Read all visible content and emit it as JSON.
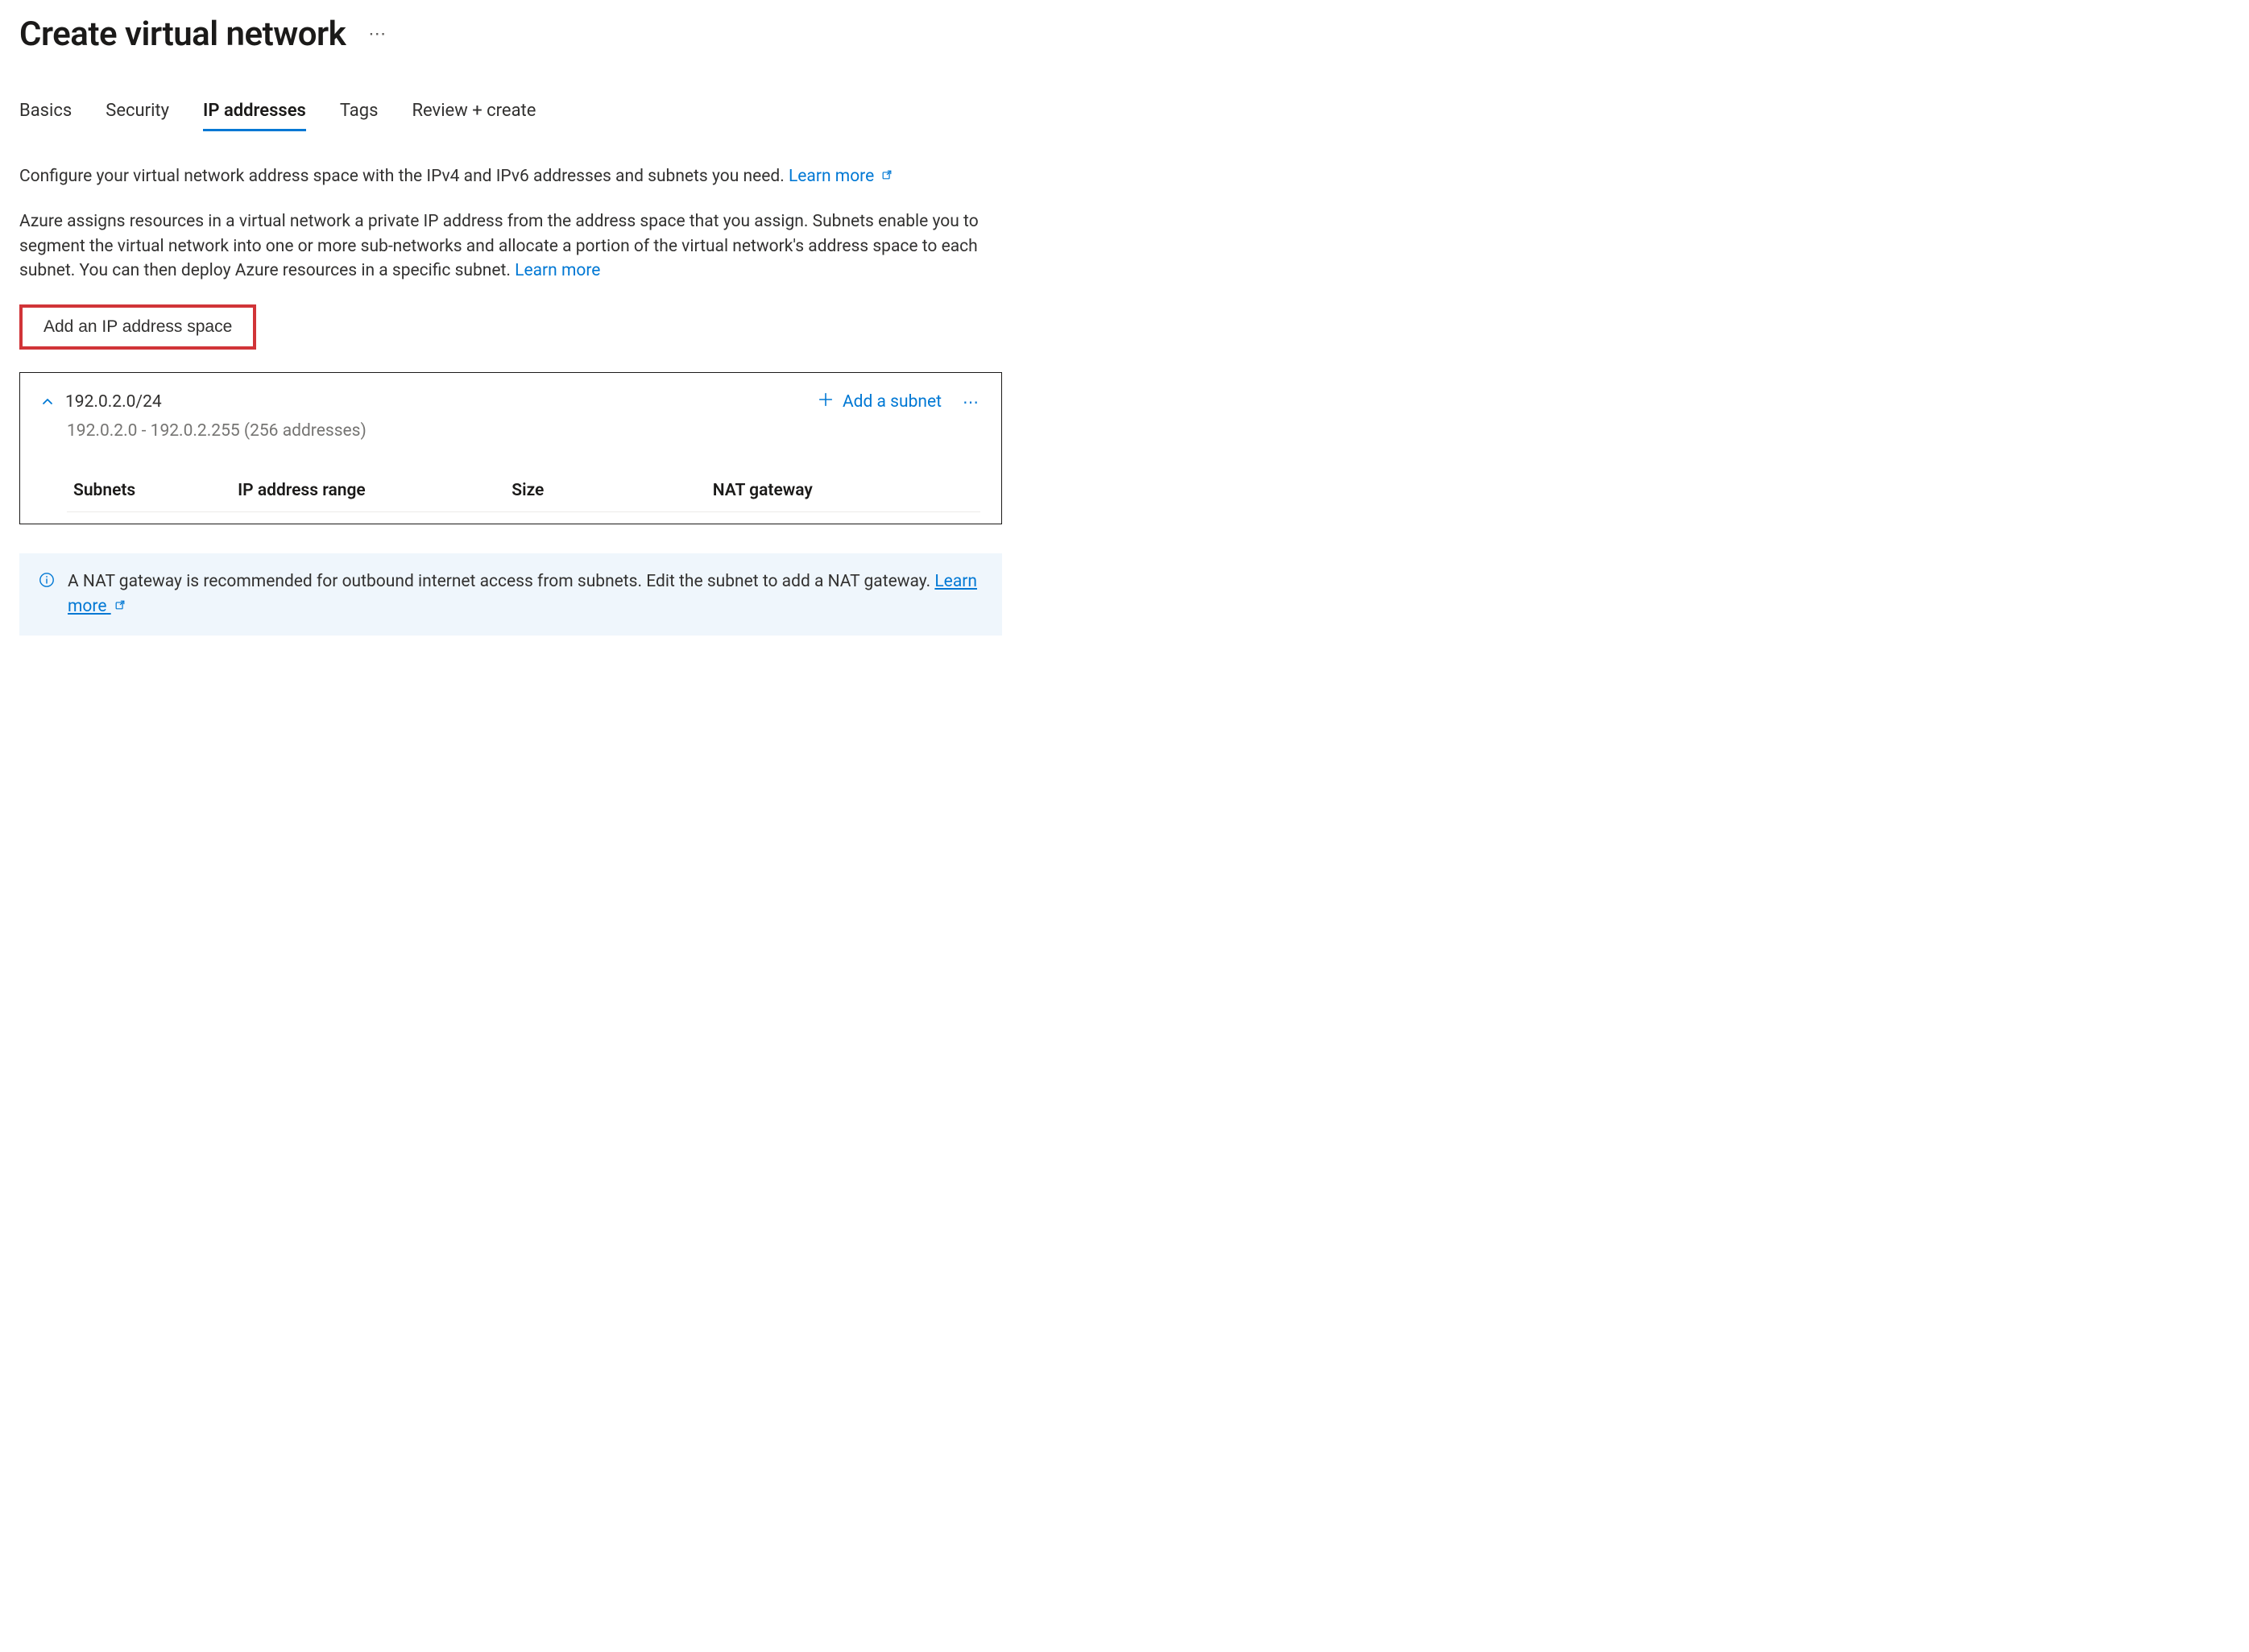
{
  "header": {
    "title": "Create virtual network"
  },
  "tabs": {
    "basics": "Basics",
    "security": "Security",
    "ip": "IP addresses",
    "tags": "Tags",
    "review": "Review + create"
  },
  "intro": {
    "line1_before_link": "Configure your virtual network address space with the IPv4 and IPv6 addresses and subnets you need. ",
    "line1_link": "Learn more",
    "line2_before_link": "Azure assigns resources in a virtual network a private IP address from the address space that you assign. Subnets enable you to segment the virtual network into one or more sub-networks and allocate a portion of the virtual network's address space to each subnet. You can then deploy Azure resources in a specific subnet. ",
    "line2_link": "Learn more"
  },
  "actions": {
    "add_address_space": "Add an IP address space",
    "add_subnet": "Add a subnet"
  },
  "address_space": {
    "cidr": "192.0.2.0/24",
    "range_text": "192.0.2.0 - 192.0.2.255 (256 addresses)",
    "columns": {
      "subnets": "Subnets",
      "range": "IP address range",
      "size": "Size",
      "nat": "NAT gateway"
    }
  },
  "banner": {
    "text": "A NAT gateway is recommended for outbound internet access from subnets. Edit the subnet to add a NAT gateway. ",
    "link": "Learn more"
  }
}
